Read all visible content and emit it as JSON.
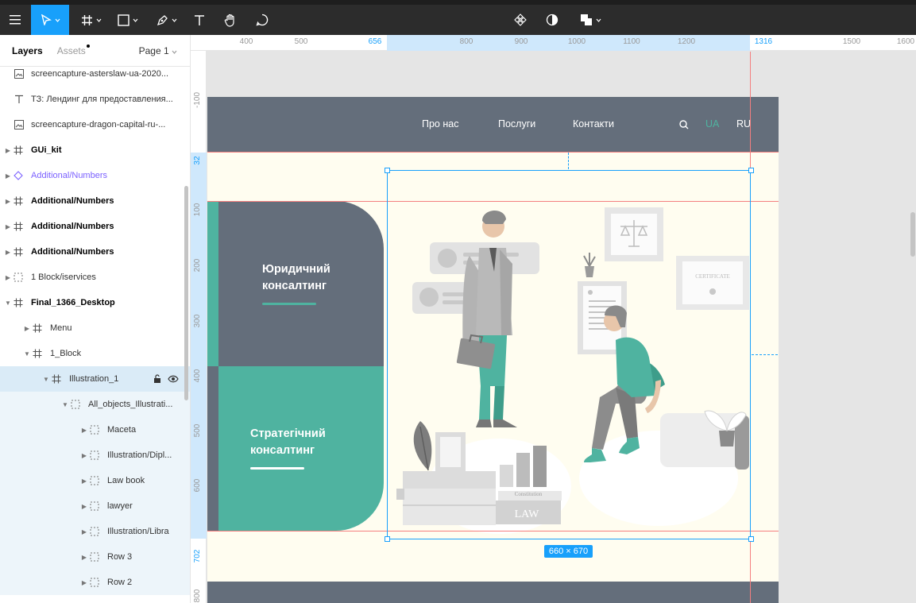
{
  "toolbar": {
    "tools": [
      "menu-icon",
      "move-tool",
      "frame-tool",
      "shape-tool",
      "pen-tool",
      "text-tool",
      "hand-tool",
      "comment-tool"
    ],
    "center_tools": [
      "component-icon",
      "contrast-icon",
      "boolean-icon"
    ]
  },
  "left_panel": {
    "tab_layers": "Layers",
    "tab_assets": "Assets",
    "page_label": "Page 1",
    "layers": [
      {
        "name": "screencapture-asterslaw-ua-2020...",
        "icon": "image-icon"
      },
      {
        "name": "ТЗ: Лендинг для предоставления...",
        "icon": "text-icon"
      },
      {
        "name": "screencapture-dragon-capital-ru-...",
        "icon": "image-icon"
      },
      {
        "name": "GUi_kit",
        "icon": "frame-icon"
      },
      {
        "name": "Additional/Numbers",
        "icon": "component-icon"
      },
      {
        "name": "Additional/Numbers",
        "icon": "frame-icon"
      },
      {
        "name": "Additional/Numbers",
        "icon": "frame-icon"
      },
      {
        "name": "Additional/Numbers",
        "icon": "frame-icon"
      },
      {
        "name": "1 Block/iservices",
        "icon": "group-icon"
      },
      {
        "name": "Final_1366_Desktop",
        "icon": "frame-icon"
      },
      {
        "name": "Menu",
        "icon": "frame-icon"
      },
      {
        "name": "1_Block",
        "icon": "frame-icon"
      },
      {
        "name": "Illustration_1",
        "icon": "frame-icon"
      },
      {
        "name": "All_objects_Illustrati...",
        "icon": "group-icon"
      },
      {
        "name": "Maceta",
        "icon": "group-icon"
      },
      {
        "name": "Illustration/Dipl...",
        "icon": "group-icon"
      },
      {
        "name": "Law book",
        "icon": "group-icon"
      },
      {
        "name": "lawyer",
        "icon": "group-icon"
      },
      {
        "name": "Illustration/Libra",
        "icon": "group-icon"
      },
      {
        "name": "Row 3",
        "icon": "group-icon"
      },
      {
        "name": "Row 2",
        "icon": "group-icon"
      }
    ]
  },
  "ruler_top": {
    "labels": [
      "400",
      "500",
      "656",
      "800",
      "900",
      "1000",
      "1100",
      "1200",
      "1316",
      "1500",
      "1600"
    ]
  },
  "ruler_left": {
    "labels": [
      "-100",
      "32",
      "100",
      "200",
      "300",
      "400",
      "500",
      "600",
      "702",
      "800"
    ]
  },
  "design": {
    "nav": {
      "about": "Про нас",
      "services": "Послуги",
      "contacts": "Контакти",
      "lang_ua": "UA",
      "lang_ru": "RU"
    },
    "card1_title_l1": "Юридичний",
    "card1_title_l2": "консалтинг",
    "card2_title_l1": "Стратегічний",
    "card2_title_l2": "консалтинг",
    "illustration": {
      "certificate": "CERTIFICATE",
      "law": "LAW",
      "constitution": "Constitution"
    }
  },
  "selection": {
    "size_label": "660 × 670"
  },
  "colors": {
    "accent": "#18a0fb",
    "teal": "#4fb3a0",
    "slate": "#646e7b",
    "guide": "#f47f7f"
  }
}
